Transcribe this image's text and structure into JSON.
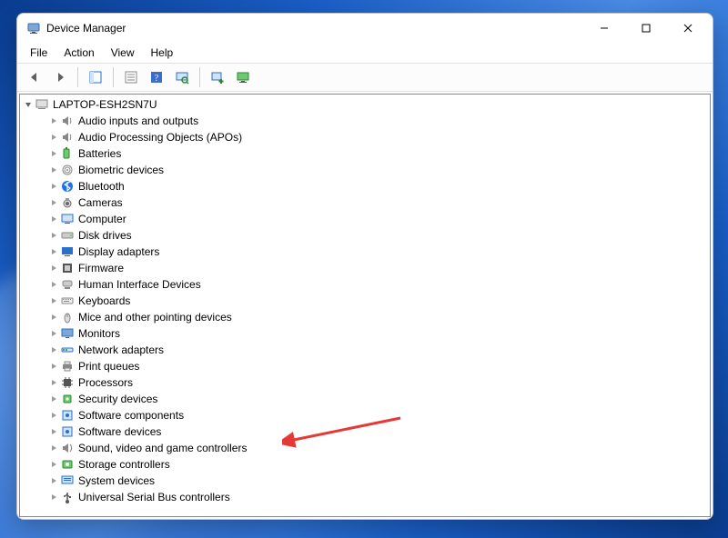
{
  "window": {
    "title": "Device Manager",
    "minimize": "—",
    "maximize": "▢",
    "close": "✕"
  },
  "menubar": {
    "items": [
      {
        "label": "File"
      },
      {
        "label": "Action"
      },
      {
        "label": "View"
      },
      {
        "label": "Help"
      }
    ]
  },
  "toolbar": {
    "back": "back-icon",
    "forward": "forward-icon",
    "show_hide_tree": "show-hide-tree-icon",
    "properties": "properties-icon",
    "help": "help-icon",
    "scan": "scan-hardware-icon",
    "add_legacy": "add-legacy-icon",
    "monitor": "device-monitor-icon"
  },
  "tree": {
    "root": {
      "label": "LAPTOP-ESH2SN7U",
      "expanded": true
    },
    "children": [
      {
        "label": "Audio inputs and outputs",
        "icon": "speaker"
      },
      {
        "label": "Audio Processing Objects (APOs)",
        "icon": "speaker"
      },
      {
        "label": "Batteries",
        "icon": "battery"
      },
      {
        "label": "Biometric devices",
        "icon": "fingerprint"
      },
      {
        "label": "Bluetooth",
        "icon": "bluetooth"
      },
      {
        "label": "Cameras",
        "icon": "camera"
      },
      {
        "label": "Computer",
        "icon": "computer"
      },
      {
        "label": "Disk drives",
        "icon": "disk"
      },
      {
        "label": "Display adapters",
        "icon": "display"
      },
      {
        "label": "Firmware",
        "icon": "firmware"
      },
      {
        "label": "Human Interface Devices",
        "icon": "hid"
      },
      {
        "label": "Keyboards",
        "icon": "keyboard"
      },
      {
        "label": "Mice and other pointing devices",
        "icon": "mouse"
      },
      {
        "label": "Monitors",
        "icon": "monitor"
      },
      {
        "label": "Network adapters",
        "icon": "network"
      },
      {
        "label": "Print queues",
        "icon": "printer"
      },
      {
        "label": "Processors",
        "icon": "processor"
      },
      {
        "label": "Security devices",
        "icon": "security"
      },
      {
        "label": "Software components",
        "icon": "software"
      },
      {
        "label": "Software devices",
        "icon": "software"
      },
      {
        "label": "Sound, video and game controllers",
        "icon": "sound",
        "highlighted": true
      },
      {
        "label": "Storage controllers",
        "icon": "storage"
      },
      {
        "label": "System devices",
        "icon": "system"
      },
      {
        "label": "Universal Serial Bus controllers",
        "icon": "usb"
      }
    ]
  }
}
